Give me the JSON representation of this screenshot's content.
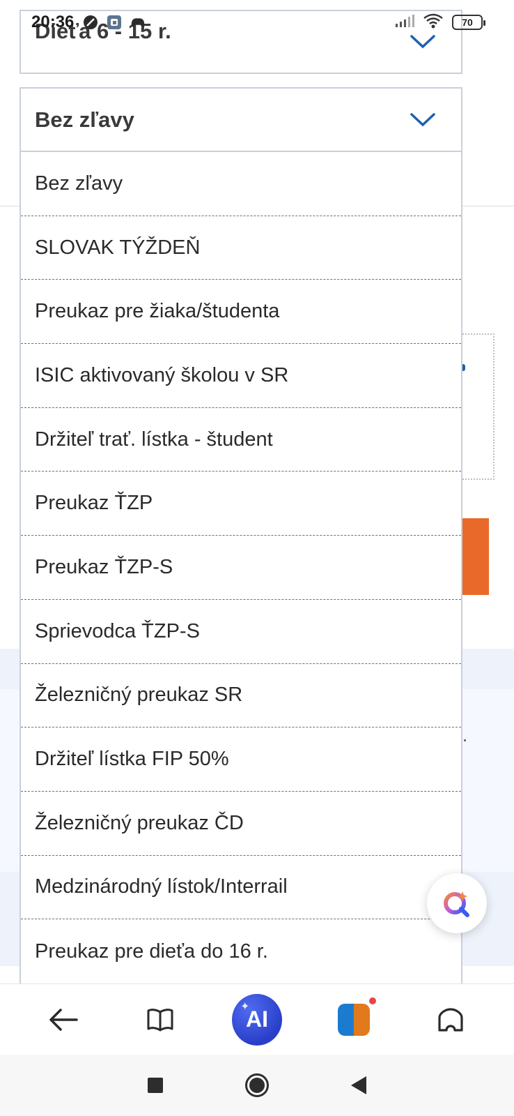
{
  "status_bar": {
    "time": "20:36",
    "battery": "70",
    "icons_left": [
      "moon-icon",
      "gallery-icon",
      "game-controller-icon"
    ],
    "icons_right": [
      "signal-icon",
      "wifi-icon",
      "battery-icon"
    ]
  },
  "form": {
    "passenger_type_value": "Dieťa 6 - 15 r.",
    "discount_value": "Bez zľavy"
  },
  "dropdown": {
    "options": [
      "Bez zľavy",
      "SLOVAK TÝŽDEŇ",
      "Preukaz pre žiaka/študenta",
      "ISIC aktivovaný školou v SR",
      "Držiteľ trať. lístka - študent",
      "Preukaz ŤZP",
      "Preukaz ŤZP-S",
      "Sprievodca ŤZP-S",
      "Železničný preukaz SR",
      "Držiteľ lístka FIP 50%",
      "Železničný preukaz ČD",
      "Medzinárodný lístok/Interrail",
      "Preukaz pre dieťa do 16 r."
    ]
  },
  "toolbar": {
    "ai_label": "AI",
    "items": [
      "back-arrow-icon",
      "book-icon",
      "ai-assistant-icon",
      "game-app-icon",
      "home-icon"
    ]
  },
  "colors": {
    "accent_blue": "#1f5fb0",
    "orange_button": "#e9692a",
    "ai_gradient": "#2a3fc9"
  }
}
